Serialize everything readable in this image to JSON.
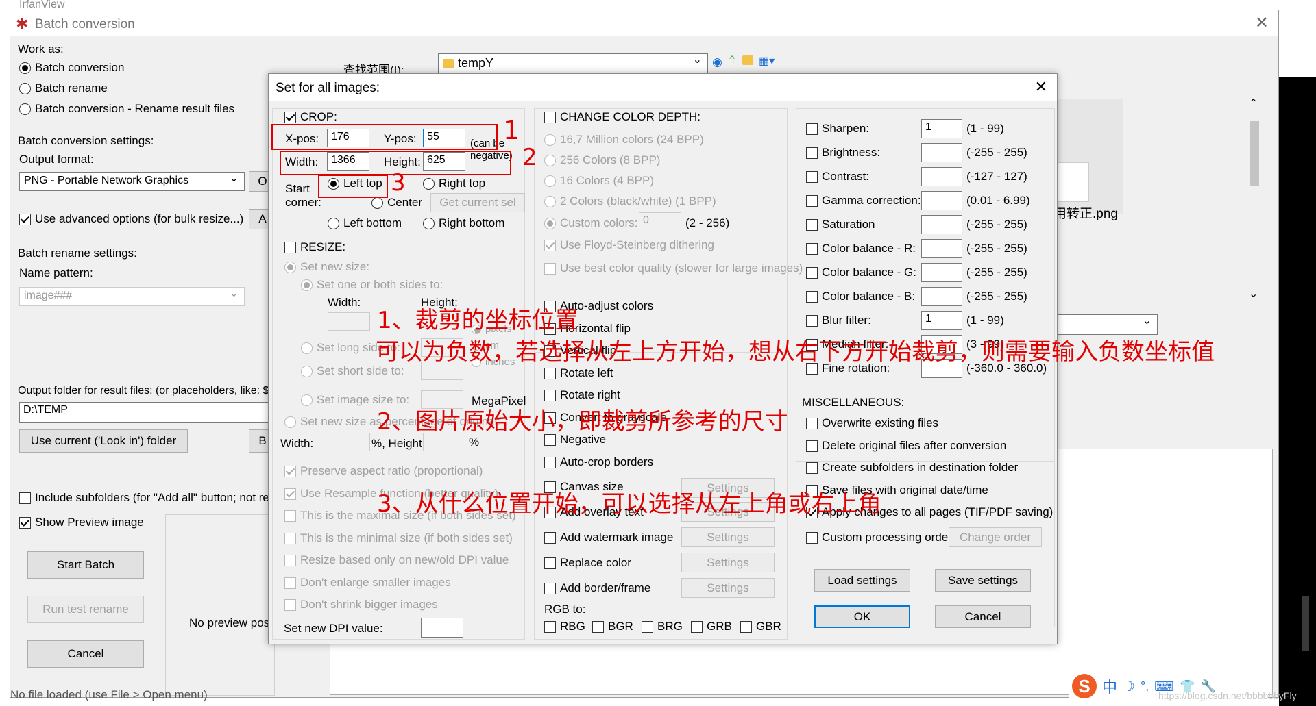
{
  "bg": {
    "app_title": "IrfanView"
  },
  "batch_window": {
    "title": "Batch conversion",
    "work_as_label": "Work as:",
    "work_as_options": [
      "Batch conversion",
      "Batch rename",
      "Batch conversion - Rename result files"
    ],
    "settings_label": "Batch conversion settings:",
    "output_format_label": "Output format:",
    "output_format_value": "PNG - Portable Network Graphics",
    "opts_btn": "O",
    "use_advanced": "Use advanced options (for bulk resize...)",
    "adv_btn": "A",
    "rename_settings_label": "Batch rename settings:",
    "name_pattern_label": "Name pattern:",
    "name_pattern_value": "image###",
    "output_folder_label": "Output folder for result files: (or placeholders, like: $D",
    "output_folder_value": "D:\\TEMP",
    "use_current_btn": "Use current ('Look in') folder",
    "browse_btn": "B",
    "include_subfolders": "Include subfolders (for \"Add all\" button; not reme",
    "show_preview": "Show Preview image",
    "start_batch": "Start Batch",
    "run_test_rename": "Run test rename",
    "cancel": "Cancel",
    "no_preview": "No preview pos",
    "status": "No file loaded (use File > Open menu)",
    "look_in_label": "查找范围(I):",
    "look_in_value": "tempY",
    "file_name": "用转正.png"
  },
  "dialog": {
    "title": "Set for all images:",
    "crop": {
      "label": "CROP:",
      "xpos_label": "X-pos:",
      "xpos": "176",
      "ypos_label": "Y-pos:",
      "ypos": "55",
      "can_be_negative": "(can be negative)",
      "width_label": "Width:",
      "width": "1366",
      "height_label": "Height:",
      "height": "625",
      "start_corner_label": "Start corner:",
      "left_top": "Left top",
      "right_top": "Right top",
      "center": "Center",
      "get_current_sel": "Get current sel",
      "left_bottom": "Left bottom",
      "right_bottom": "Right bottom"
    },
    "resize": {
      "label": "RESIZE:",
      "set_new_size": "Set new size:",
      "set_one_or_both": "Set one or both sides to:",
      "width_label": "Width:",
      "height_label": "Height:",
      "pixels": "pixels",
      "cm": "cm",
      "inches": "inches",
      "set_long_side": "Set long side to:",
      "set_short_side": "Set short side to:",
      "set_image_size": "Set image size to:",
      "megapixel": "MegaPixel",
      "set_percentage": "Set new size as percentage of original:",
      "pct_width_label": "Width:",
      "pct_height_label": "%, Height:",
      "pct": "%",
      "preserve_aspect": "Preserve aspect ratio (proportional)",
      "use_resample": "Use Resample function (better quality)",
      "maximal": "This is the maximal size (if both sides set)",
      "minimal": "This is the minimal size (if both sides set)",
      "dpi_only": "Resize based only on new/old DPI value",
      "dont_enlarge": "Don't enlarge smaller images",
      "dont_shrink": "Don't shrink bigger images",
      "set_dpi": "Set new DPI value:"
    },
    "color_depth": {
      "label": "CHANGE COLOR DEPTH:",
      "options": [
        "16,7 Million colors (24 BPP)",
        "256 Colors (8 BPP)",
        "16 Colors (4 BPP)",
        "2 Colors (black/white) (1 BPP)",
        "Custom colors:"
      ],
      "custom_value": "0",
      "custom_range": "(2 - 256)",
      "floyd": "Use Floyd-Steinberg dithering",
      "best_quality": "Use best color quality (slower for large images)"
    },
    "transforms": [
      "Auto-adjust colors",
      "Horizontal flip",
      "Vertical flip",
      "Rotate left",
      "Rotate right",
      "Convert to grayscale",
      "Negative",
      "Auto-crop borders"
    ],
    "setting_items": [
      "Canvas size",
      "Add overlay text",
      "Add watermark image",
      "Replace color",
      "Add border/frame"
    ],
    "settings_btn": "Settings",
    "rgb_label": "RGB to:",
    "rgb_options": [
      "RBG",
      "BGR",
      "BRG",
      "GRB",
      "GBR"
    ],
    "filters": [
      {
        "label": "Sharpen:",
        "value": "1",
        "range": "(1  -  99)"
      },
      {
        "label": "Brightness:",
        "value": "",
        "range": "(-255  -  255)"
      },
      {
        "label": "Contrast:",
        "value": "",
        "range": "(-127  -  127)"
      },
      {
        "label": "Gamma correction:",
        "value": "",
        "range": "(0.01  -  6.99)"
      },
      {
        "label": "Saturation",
        "value": "",
        "range": "(-255  -  255)"
      },
      {
        "label": "Color balance - R:",
        "value": "",
        "range": "(-255  -  255)"
      },
      {
        "label": "Color balance - G:",
        "value": "",
        "range": "(-255  -  255)"
      },
      {
        "label": "Color balance - B:",
        "value": "",
        "range": "(-255  -  255)"
      },
      {
        "label": "Blur filter:",
        "value": "1",
        "range": "(1  -  99)"
      },
      {
        "label": "Median filter:",
        "value": "",
        "range": "(3  -  99)"
      },
      {
        "label": "Fine rotation:",
        "value": "",
        "range": "(-360.0  -  360.0)"
      }
    ],
    "misc_label": "MISCELLANEOUS:",
    "misc": [
      "Overwrite existing files",
      "Delete original files after conversion",
      "Create subfolders in destination folder",
      "Save files with original date/time",
      "Apply changes to all pages (TIF/PDF saving)",
      "Custom processing order"
    ],
    "change_order": "Change order",
    "load_settings": "Load settings",
    "save_settings": "Save settings",
    "ok": "OK",
    "cancel": "Cancel"
  },
  "annotations": {
    "n1": "1",
    "n2": "2",
    "n3": "3",
    "a1": "1、裁剪的坐标位置",
    "a1b": "可以为负数，若选择从左上方开始，想从右下方开始裁剪，则需要输入负数坐标值",
    "a2": "2、图片原始大小，即裁剪所参考的尺寸",
    "a3": "3、从什么位置开始，可以选择从左上角或右上角"
  },
  "watermark": "https://blog.csdn.net/bbbbbbyFly",
  "ime": [
    "中",
    "☽",
    "°,",
    "⌨",
    "👕",
    "🔧"
  ]
}
